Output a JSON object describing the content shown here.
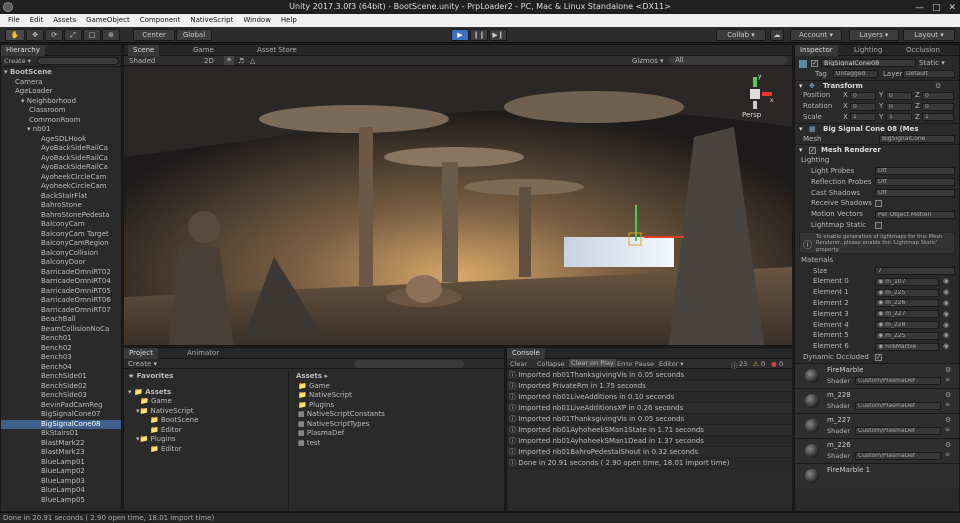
{
  "window": {
    "title": "Unity 2017.3.0f3 (64bit) - BootScene.unity - PrpLoader2 - PC, Mac & Linux Standalone <DX11>"
  },
  "menu": [
    "File",
    "Edit",
    "Assets",
    "GameObject",
    "Component",
    "NativeScript",
    "Window",
    "Help"
  ],
  "toolbar": {
    "center": "Center",
    "global": "Global",
    "collab": "Collab ▾",
    "account": "Account ▾",
    "layers": "Layers ▾",
    "layout": "Layout ▾"
  },
  "hierarchy": {
    "tab": "Hierarchy",
    "create": "Create ▾",
    "scene": "BootScene",
    "items": [
      "Camera",
      "AgeLoader",
      "Neighborhood",
      "Classroom",
      "CommonRoom",
      "nb01",
      "AgeSDLHook",
      "AyoBackSideRailCa",
      "AyoBackSideRailCa",
      "AyoBackSideRailCa",
      "AyoheekCircleCam",
      "AyoheekCircleCam",
      "BackStairFlat",
      "BahroStone",
      "BahroStonePedesta",
      "BalconyCam",
      "BalconyCam Target",
      "BalconyCamRegion",
      "BalconyCollision",
      "BalconyDoor",
      "BarricadeOmniRT02",
      "BarricadeOmniRT04",
      "BarricadeOmniRT05",
      "BarricadeOmniRT06",
      "BarricadeOmniRT07",
      "BeachBall",
      "BeamCollisionNoCa",
      "Bench01",
      "Bench02",
      "Bench03",
      "Bench04",
      "BenchSide01",
      "BenchSide02",
      "BenchSide03",
      "BevinPadCamReg",
      "BigSignalCone07",
      "BigSignalCone08",
      "BkStairs01",
      "BlastMark22",
      "BlastMark23",
      "BlueLamp01",
      "BlueLamp02",
      "BlueLamp03",
      "BlueLamp04",
      "BlueLamp05"
    ],
    "selected": "BigSignalCone08"
  },
  "scene": {
    "tabs": [
      "Scene",
      "Game",
      "Asset Store"
    ],
    "shaded": "Shaded",
    "mode2d": "2D",
    "gizmos": "Gizmos ▾",
    "search": "All",
    "persp": "Persp",
    "axis_y": "y",
    "axis_x": "x"
  },
  "project": {
    "tabs": [
      "Project",
      "Animator"
    ],
    "create": "Create ▾",
    "favorites": "Favorites",
    "tree": [
      "Assets",
      "Game",
      "NativeScript",
      "BootScene",
      "Editor",
      "Plugins",
      "Editor"
    ],
    "assets_header": "Assets ▸",
    "assets": [
      "Game",
      "NativeScript",
      "Plugins",
      "NativeScriptConstants",
      "NativeScriptTypes",
      "PlasmaDef",
      "test"
    ]
  },
  "console": {
    "tab": "Console",
    "buttons": [
      "Clear",
      "Collapse",
      "Clear on Play",
      "Error Pause",
      "Editor ▾"
    ],
    "counts": {
      "logs": "23",
      "warnings": "0",
      "errors": "0"
    },
    "lines": [
      "Imported nb01ThanksgivingVis in  0.05 seconds",
      "Imported PrivateRm in   1.75 seconds",
      "Imported nb01LiveAdditions in   0.10 seconds",
      "Imported nb01LiveAdditionsXP in   0.26 seconds",
      "Imported nb01ThanksgivingVis in   0.05 seconds",
      "Imported nb01AyhoheekSMan1State in   1.71 seconds",
      "Imported nb01AyhoheekSMan1Dead in   1.37 seconds",
      "Imported nb01BahroPedestalShout in   0.32 seconds",
      "Done in  20.91 seconds  ( 2.90 open time,  18.01 import time)"
    ]
  },
  "inspector": {
    "tabs": [
      "Inspector",
      "Lighting",
      "Occlusion"
    ],
    "name": "BigSignalCone08",
    "static": "Static ▾",
    "tag_label": "Tag",
    "tag": "Untagged",
    "layer_label": "Layer",
    "layer": "Default",
    "transform": {
      "title": "Transform",
      "position": [
        "0",
        "0",
        "0"
      ],
      "rotation": [
        "0",
        "0",
        "0"
      ],
      "scale": [
        "1",
        "1",
        "1"
      ]
    },
    "mesh_filter": {
      "title": "Big Signal Cone 08 (Mes",
      "mesh_label": "Mesh",
      "mesh": "BigSignalCone"
    },
    "renderer": {
      "title": "Mesh Renderer",
      "lighting": "Lighting",
      "light_probes": "Off",
      "reflection_probes": "Off",
      "cast_shadows": "Off",
      "motion_vectors": "Per Object Motion",
      "info": "To enable generation of lightmaps for this Mesh Renderer, please enable the 'Lightmap Static' property.",
      "materials": "Materials",
      "size": "7",
      "elements": [
        "m_107",
        "m_225",
        "m_226",
        "m_227",
        "m_228",
        "m_225",
        "FireMarble"
      ],
      "dynamic_occluded": "Dynamic Occluded"
    },
    "material_cards": [
      {
        "name": "FireMarble",
        "shader": "Custom/PlasmaDef"
      },
      {
        "name": "m_228",
        "shader": "Custom/PlasmaDef"
      },
      {
        "name": "m_227",
        "shader": "Custom/PlasmaDef"
      },
      {
        "name": "m_226",
        "shader": "Custom/PlasmaDef"
      },
      {
        "name": "FireMarble 1",
        "shader": ""
      }
    ]
  },
  "status": "Done in  20.91 seconds  ( 2.90 open time,  18.01 import time)"
}
